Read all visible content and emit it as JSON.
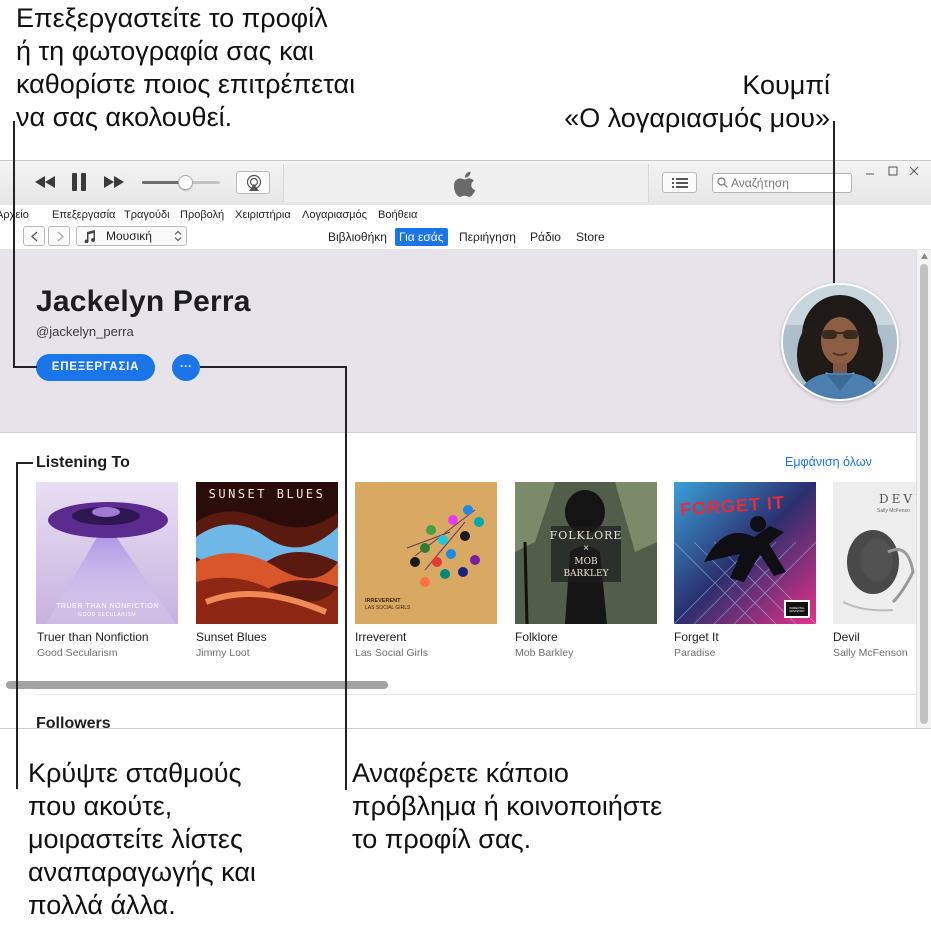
{
  "callouts": {
    "top_left": [
      "Επεξεργαστείτε το προφίλ",
      "ή τη φωτογραφία σας και",
      "καθορίστε ποιος επιτρέπεται",
      "να σας ακολουθεί."
    ],
    "top_right": [
      "Κουμπί",
      "«Ο λογαριασμός μου»"
    ],
    "bottom_left": [
      "Κρύψτε σταθμούς",
      "που ακούτε,",
      "μοιραστείτε λίστες",
      "αναπαραγωγής και",
      "πολλά άλλα."
    ],
    "bottom_right": [
      "Αναφέρετε κάποιο",
      "πρόβλημα ή κοινοποιήστε",
      "το προφίλ σας."
    ]
  },
  "toolbar": {
    "search_placeholder": "Αναζήτηση",
    "volume_level": 0.55
  },
  "menu": [
    "Αρχείο",
    "Επεξεργασία",
    "Τραγούδι",
    "Προβολή",
    "Χειριστήρια",
    "Λογαριασμός",
    "Βοήθεια"
  ],
  "nav": {
    "media_selector": "Μουσική",
    "tabs": [
      "Βιβλιοθήκη",
      "Για εσάς",
      "Περιήγηση",
      "Ράδιο",
      "Store"
    ],
    "active_tab": "Για εσάς"
  },
  "profile": {
    "name": "Jackelyn Perra",
    "handle": "@jackelyn_perra",
    "edit_button": "ΕΠΕΞΕΡΓΑΣΙΑ",
    "more_button": "···"
  },
  "listening": {
    "heading": "Listening To",
    "see_all": "Εμφάνιση όλων",
    "albums": [
      {
        "title": "Truer than Nonfiction",
        "artist": "Good Secularism",
        "cover_text": "TRUER THAN NONFICTION",
        "cover_sub": "GOOD SECULARISM"
      },
      {
        "title": "Sunset Blues",
        "artist": "Jimmy Loot",
        "cover_text": "SUNSET BLUES"
      },
      {
        "title": "Irreverent",
        "artist": "Las Social Girls",
        "cover_text": "IRREVERENT",
        "cover_sub": "LAS SOCIAL GIRLS"
      },
      {
        "title": "Folklore",
        "artist": "Mob Barkley",
        "cover_text": "FOLKLORE",
        "cover_sub": "MOB",
        "cover_sub2": "BARKLEY",
        "cover_x": "×"
      },
      {
        "title": "Forget It",
        "artist": "Paradise",
        "cover_text": "FORGET IT",
        "cover_badge": "PARENTAL ADVISORY"
      },
      {
        "title": "Devil",
        "artist": "Sally McFenson",
        "cover_text": "DEVI",
        "cover_sub": "Sally McFenso"
      }
    ],
    "scroll_fraction": 0.42
  },
  "followers": {
    "heading": "Followers"
  },
  "colors": {
    "accent": "#1a75e8",
    "header_bg": "#e6e3ea"
  }
}
